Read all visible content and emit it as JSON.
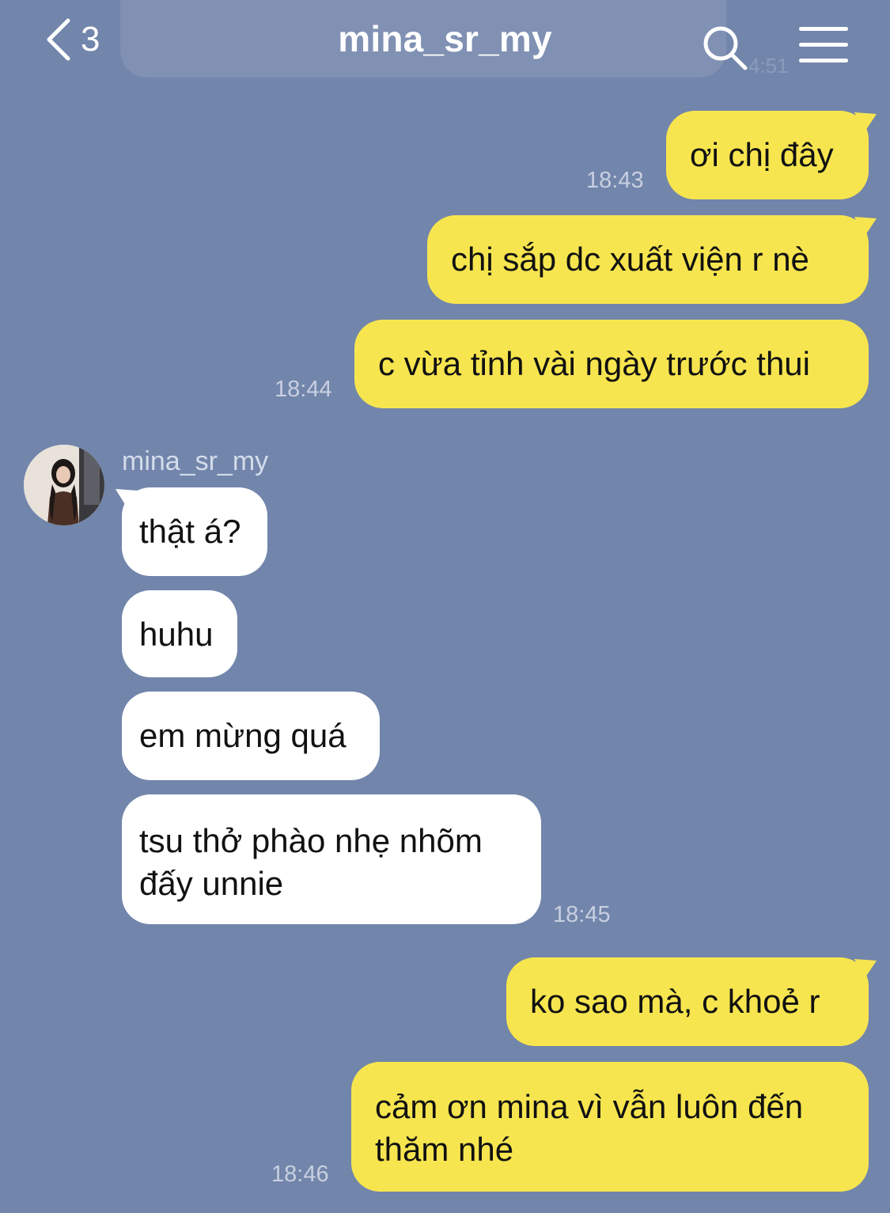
{
  "header": {
    "back_count": "3",
    "title": "mina_sr_my",
    "ghost_time": "4:51"
  },
  "colors": {
    "background": "#7285ab",
    "outgoing_bubble": "#f7e54f",
    "incoming_bubble": "#ffffff"
  },
  "icons": {
    "back": "chevron-left-icon",
    "search": "search-icon",
    "menu": "hamburger-menu-icon"
  },
  "sender": {
    "name": "mina_sr_my"
  },
  "messages": [
    {
      "direction": "out",
      "text": "ơi chị đây"
    },
    {
      "direction": "out",
      "text": "chị sắp dc xuất viện r nè"
    },
    {
      "direction": "out",
      "text": "c vừa tỉnh vài ngày trước thui"
    },
    {
      "direction": "in",
      "text": "thật á?"
    },
    {
      "direction": "in",
      "text": "huhu"
    },
    {
      "direction": "in",
      "text": "em mừng quá"
    },
    {
      "direction": "in",
      "text": "tsu thở phào nhẹ nhõm đấy unnie"
    },
    {
      "direction": "out",
      "text": "ko sao mà, c khoẻ r"
    },
    {
      "direction": "out",
      "text": "cảm ơn mina vì vẫn luôn đến thăm nhé"
    }
  ],
  "timestamps": [
    "18:43",
    "18:44",
    "18:45",
    "18:46"
  ]
}
